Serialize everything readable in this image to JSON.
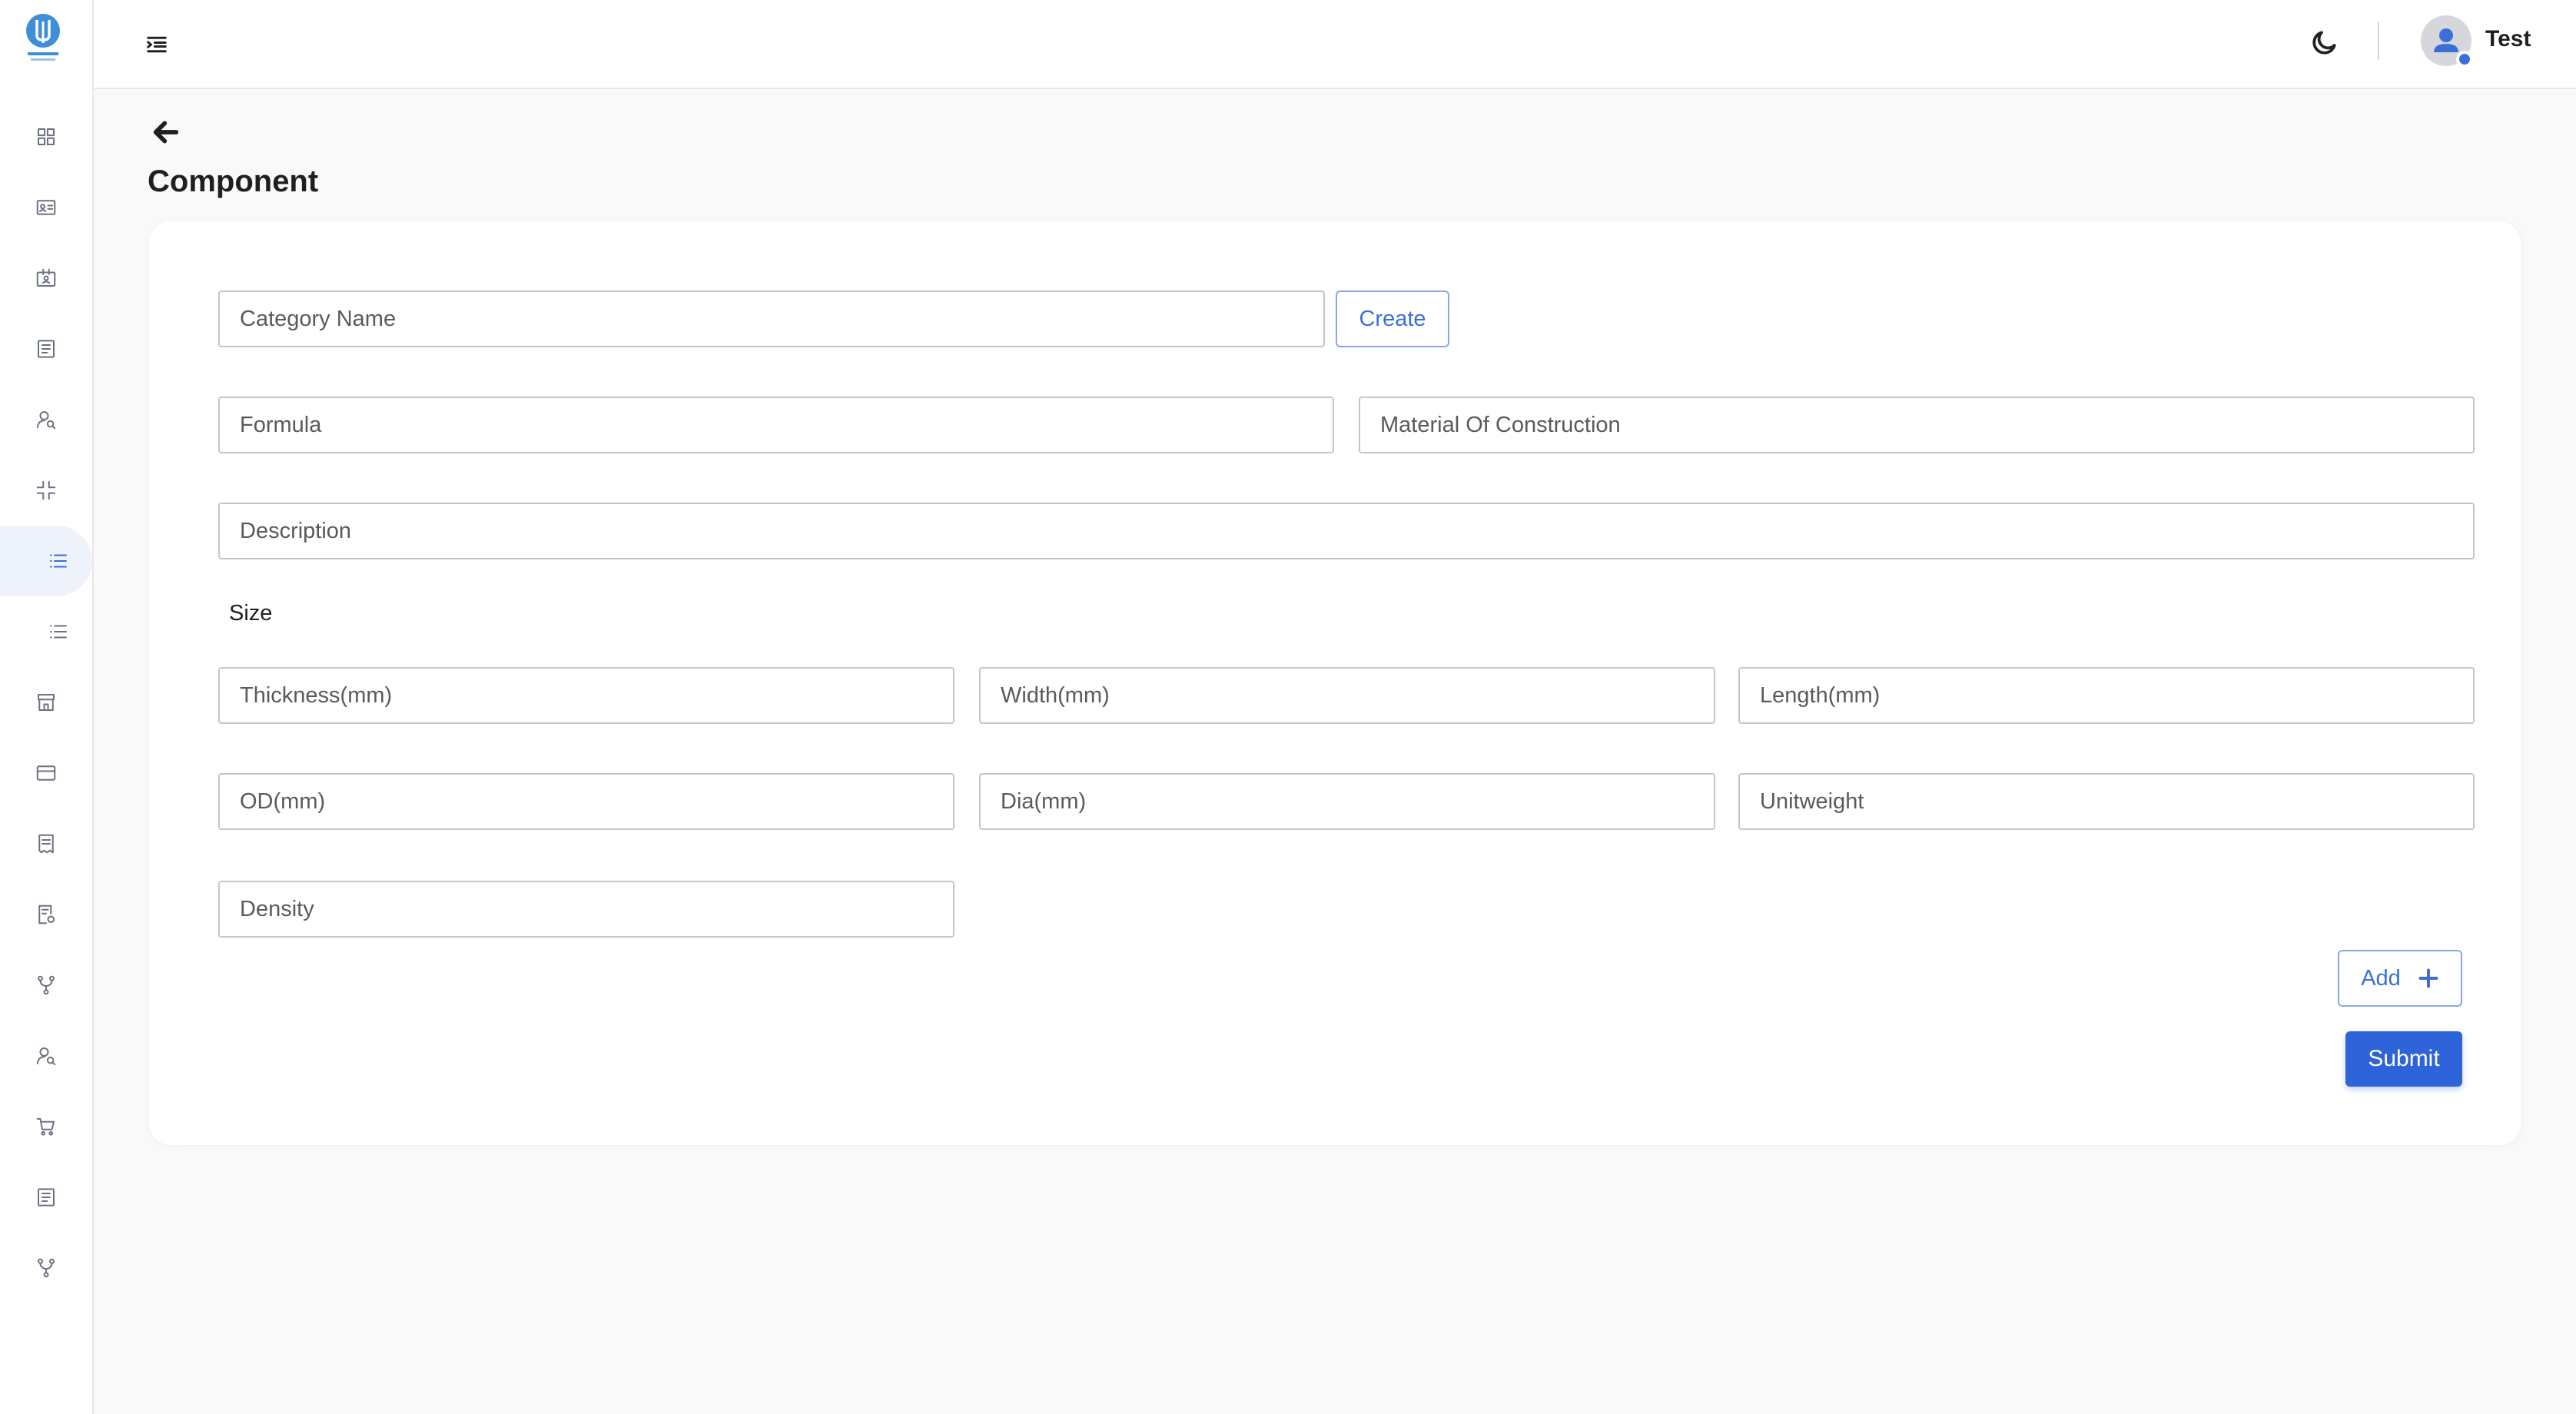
{
  "header": {
    "user_name": "Test"
  },
  "page": {
    "title": "Component"
  },
  "form": {
    "category_name_placeholder": "Category Name",
    "create_label": "Create",
    "formula_placeholder": "Formula",
    "material_placeholder": "Material Of Construction",
    "description_placeholder": "Description",
    "size_label": "Size",
    "thickness_placeholder": "Thickness(mm)",
    "width_placeholder": "Width(mm)",
    "length_placeholder": "Length(mm)",
    "od_placeholder": "OD(mm)",
    "dia_placeholder": "Dia(mm)",
    "unitweight_placeholder": "Unitweight",
    "density_placeholder": "Density",
    "add_label": "Add",
    "submit_label": "Submit"
  },
  "sidebar": {
    "items": [
      {
        "icon": "dashboard-grid-icon"
      },
      {
        "icon": "id-card-icon"
      },
      {
        "icon": "badge-icon"
      },
      {
        "icon": "document-list-icon"
      },
      {
        "icon": "user-search-icon"
      },
      {
        "icon": "compress-icon"
      },
      {
        "icon": "list-icon",
        "active": true
      },
      {
        "icon": "list-icon"
      },
      {
        "icon": "store-icon"
      },
      {
        "icon": "credit-card-icon"
      },
      {
        "icon": "receipt-icon"
      },
      {
        "icon": "report-settings-icon"
      },
      {
        "icon": "branch-icon"
      },
      {
        "icon": "user-search-icon"
      },
      {
        "icon": "cart-icon"
      },
      {
        "icon": "document-list-icon"
      },
      {
        "icon": "branch-icon"
      }
    ]
  },
  "colors": {
    "accent": "#2e63d9",
    "active_bg": "#edf2fb",
    "avatar_status": "#3b6fd6"
  }
}
